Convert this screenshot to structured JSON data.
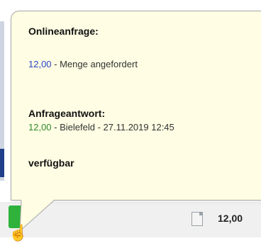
{
  "tooltip": {
    "title": "Onlineanfrage:",
    "request_qty": "12,00",
    "request_text": " - Menge angefordert",
    "response_title": "Anfrageantwort:",
    "response_qty": "12,00",
    "response_text": " - Bielefeld - 27.11.2019 12:45",
    "status": "verfügbar"
  },
  "row": {
    "quantity": "12,00",
    "status_color": "#2fb23b"
  },
  "colors": {
    "tooltip_bg": "#fffde3",
    "requested_qty": "#2946c8",
    "answered_qty": "#2f8a2a"
  },
  "icons": {
    "document": "document-icon",
    "cursor": "hand-pointer-icon"
  }
}
